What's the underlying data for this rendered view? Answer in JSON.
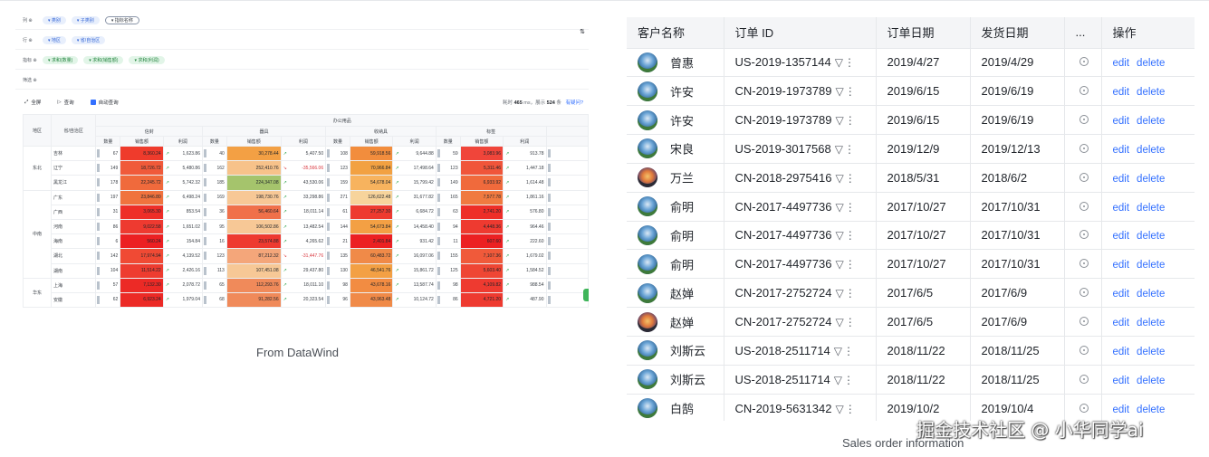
{
  "datawind": {
    "shelves": [
      {
        "label": "列 ⊕",
        "pills": [
          {
            "text": "▾ 类别",
            "kind": "dim"
          },
          {
            "text": "▾ 子类别",
            "kind": "dim"
          },
          {
            "text": "▾ 指标名称",
            "kind": "dim-o"
          }
        ]
      },
      {
        "label": "行 ⊕",
        "pills": [
          {
            "text": "▾ 地区",
            "kind": "dim"
          },
          {
            "text": "▾ 省/自治区",
            "kind": "dim"
          }
        ]
      },
      {
        "label": "指标 ⊕",
        "pills": [
          {
            "text": "▾ 求和(数量)",
            "kind": "mea"
          },
          {
            "text": "▾ 求和(销售额)",
            "kind": "mea"
          },
          {
            "text": "▾ 求和(利润)",
            "kind": "mea"
          }
        ]
      },
      {
        "label": "筛选 ⊕",
        "pills": []
      }
    ],
    "toolbar": {
      "fullscreen": "全屏",
      "query": "查询",
      "auto_query": "自动查询",
      "status_prefix": "耗时",
      "time": "465",
      "status_mid": "ms，展示",
      "count": "524",
      "status_suffix": "条",
      "link": "有疑问?"
    },
    "header": {
      "region": "地区",
      "province": "省/自治区",
      "category": "办公用品",
      "subcats": [
        "信封",
        "器具",
        "收纳具",
        "标签"
      ],
      "measures": [
        "数量",
        "销售额",
        "利润"
      ]
    },
    "rows": [
      {
        "region": "东北",
        "span": 3,
        "prov": "吉林",
        "cells": [
          [
            "67",
            "8,360.24",
            "↗ 1,623.86"
          ],
          [
            "40",
            "30,278.44",
            "↗ 5,407.50"
          ],
          [
            "108",
            "59,918.56",
            "↗ 9,644.88"
          ],
          [
            "59",
            "3,083.96",
            "↗ 913.78"
          ]
        ]
      },
      {
        "prov": "辽宁",
        "cells": [
          [
            "149",
            "18,726.72",
            "↗ 5,480.86"
          ],
          [
            "162",
            "252,410.76",
            "↘ -35,566.06"
          ],
          [
            "123",
            "70,966.84",
            "↗ 17,498.64"
          ],
          [
            "123",
            "5,311.46",
            "↗ 1,447.18"
          ]
        ]
      },
      {
        "prov": "黑龙江",
        "cells": [
          [
            "178",
            "22,245.72",
            "↗ 5,742.32"
          ],
          [
            "185",
            "224,347.08",
            "↗ 43,530.06"
          ],
          [
            "159",
            "54,678.04",
            "↗ 15,799.42"
          ],
          [
            "149",
            "6,933.92",
            "↗ 1,614.48"
          ]
        ]
      },
      {
        "region": "中南",
        "span": 6,
        "prov": "广东",
        "cells": [
          [
            "197",
            "23,846.80",
            "↗ 6,498.24"
          ],
          [
            "169",
            "198,730.76",
            "↗ 33,298.86"
          ],
          [
            "271",
            "126,622.48",
            "↗ 31,677.82"
          ],
          [
            "165",
            "7,577.78",
            "↗ 1,861.16"
          ]
        ]
      },
      {
        "prov": "广西",
        "cells": [
          [
            "31",
            "3,065.30",
            "↗ 853.54"
          ],
          [
            "36",
            "56,460.64",
            "↗ 18,011.14"
          ],
          [
            "61",
            "27,257.30",
            "↗ 6,684.72"
          ],
          [
            "63",
            "2,741.20",
            "↗ 576.80"
          ]
        ]
      },
      {
        "prov": "河南",
        "cells": [
          [
            "86",
            "9,022.58",
            "↗ 1,651.02"
          ],
          [
            "95",
            "106,502.86",
            "↗ 13,482.54"
          ],
          [
            "144",
            "54,673.84",
            "↗ 14,458.40"
          ],
          [
            "94",
            "4,448.36",
            "↗ 964.46"
          ]
        ]
      },
      {
        "prov": "海南",
        "cells": [
          [
            "6",
            "560.24",
            "↗ 154.84"
          ],
          [
            "16",
            "23,574.88",
            "↗ 4,265.62"
          ],
          [
            "21",
            "2,401.84",
            "↗ 931.42"
          ],
          [
            "11",
            "607.60",
            "↗ 222.60"
          ]
        ]
      },
      {
        "prov": "湖北",
        "cells": [
          [
            "142",
            "17,974.94",
            "↗ 4,139.52"
          ],
          [
            "123",
            "87,212.32",
            "↘ -31,447.76"
          ],
          [
            "135",
            "60,483.72",
            "↗ 16,097.06"
          ],
          [
            "155",
            "7,107.36",
            "↗ 1,679.02"
          ]
        ]
      },
      {
        "prov": "湖南",
        "cells": [
          [
            "104",
            "11,514.22",
            "↗ 2,426.16"
          ],
          [
            "113",
            "107,451.08",
            "↗ 29,437.80"
          ],
          [
            "130",
            "46,541.76",
            "↗ 15,861.72"
          ],
          [
            "125",
            "5,603.40",
            "↗ 1,584.52"
          ]
        ]
      },
      {
        "region": "华东",
        "span": 2,
        "prov": "上海",
        "cells": [
          [
            "57",
            "7,132.30",
            "↗ 2,078.72"
          ],
          [
            "65",
            "112,293.76",
            "↗ 18,011.10"
          ],
          [
            "98",
            "43,678.16",
            "↗ 13,587.74"
          ],
          [
            "98",
            "4,109.82",
            "↗ 988.54"
          ]
        ]
      },
      {
        "prov": "安徽",
        "cells": [
          [
            "62",
            "6,923.24",
            "↗ 1,979.04"
          ],
          [
            "68",
            "91,282.56",
            "↗ 20,323.54"
          ],
          [
            "96",
            "43,963.48",
            "↗ 10,124.72"
          ],
          [
            "86",
            "4,721.20",
            "↗ 487.90"
          ]
        ]
      }
    ],
    "sales_colors": [
      [
        "#ef3b2c",
        "#f3a044",
        "#f28d3d",
        "#f0453a"
      ],
      [
        "#f05a3a",
        "#f7c28a",
        "#f2a142",
        "#f0553a"
      ],
      [
        "#f06a3c",
        "#a5c46c",
        "#f7b35e",
        "#f06a3c"
      ],
      [
        "#f0733e",
        "#f7c896",
        "#f7d49c",
        "#f07a40"
      ],
      [
        "#ee2e28",
        "#f0704a",
        "#ee3a30",
        "#ee2e28"
      ],
      [
        "#ee3a30",
        "#f7c896",
        "#f3a044",
        "#ee3a30"
      ],
      [
        "#ec2022",
        "#ee3a30",
        "#ec2022",
        "#ec2022"
      ],
      [
        "#f04a34",
        "#f4a67a",
        "#f08a48",
        "#f05a3a"
      ],
      [
        "#ee3c30",
        "#f7c896",
        "#f3a044",
        "#ef4634"
      ],
      [
        "#ec2a26",
        "#f08a5a",
        "#f28c42",
        "#ee3a30"
      ],
      [
        "#ec2a26",
        "#f08a5a",
        "#f08a48",
        "#ee3a30"
      ]
    ],
    "caption": "From DataWind"
  },
  "orders": {
    "columns": [
      "客户名称",
      "订单 ID",
      "订单日期",
      "发货日期",
      "...",
      "操作"
    ],
    "edit_label": "edit",
    "delete_label": "delete",
    "rows": [
      {
        "name": "曾惠",
        "id": "US-2019-1357144",
        "order": "2019/4/27",
        "ship": "2019/4/29",
        "avatar": "lake"
      },
      {
        "name": "许安",
        "id": "CN-2019-1973789",
        "order": "2019/6/15",
        "ship": "2019/6/19",
        "avatar": "lake"
      },
      {
        "name": "许安",
        "id": "CN-2019-1973789",
        "order": "2019/6/15",
        "ship": "2019/6/19",
        "avatar": "lake"
      },
      {
        "name": "宋良",
        "id": "US-2019-3017568",
        "order": "2019/12/9",
        "ship": "2019/12/13",
        "avatar": "lake"
      },
      {
        "name": "万兰",
        "id": "CN-2018-2975416",
        "order": "2018/5/31",
        "ship": "2018/6/2",
        "avatar": "sunset"
      },
      {
        "name": "俞明",
        "id": "CN-2017-4497736",
        "order": "2017/10/27",
        "ship": "2017/10/31",
        "avatar": "lake"
      },
      {
        "name": "俞明",
        "id": "CN-2017-4497736",
        "order": "2017/10/27",
        "ship": "2017/10/31",
        "avatar": "lake"
      },
      {
        "name": "俞明",
        "id": "CN-2017-4497736",
        "order": "2017/10/27",
        "ship": "2017/10/31",
        "avatar": "lake"
      },
      {
        "name": "赵婵",
        "id": "CN-2017-2752724",
        "order": "2017/6/5",
        "ship": "2017/6/9",
        "avatar": "lake"
      },
      {
        "name": "赵婵",
        "id": "CN-2017-2752724",
        "order": "2017/6/5",
        "ship": "2017/6/9",
        "avatar": "sunset"
      },
      {
        "name": "刘斯云",
        "id": "US-2018-2511714",
        "order": "2018/11/22",
        "ship": "2018/11/25",
        "avatar": "lake"
      },
      {
        "name": "刘斯云",
        "id": "US-2018-2511714",
        "order": "2018/11/22",
        "ship": "2018/11/25",
        "avatar": "lake"
      },
      {
        "name": "白鹄",
        "id": "CN-2019-5631342",
        "order": "2019/10/2",
        "ship": "2019/10/4",
        "avatar": "lake"
      }
    ],
    "caption": "Sales order information"
  },
  "watermark": "掘金技术社区 @ 小华同学ai"
}
